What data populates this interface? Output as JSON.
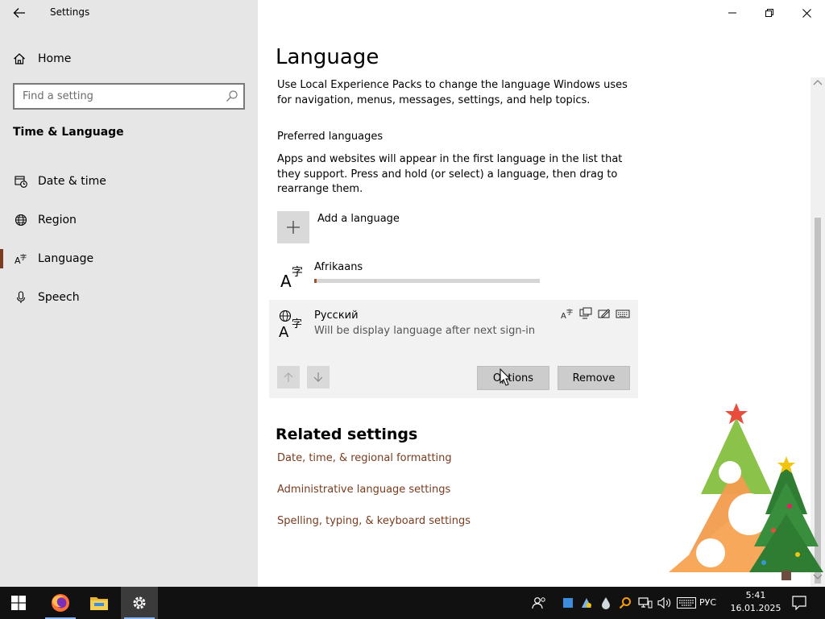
{
  "app": {
    "title": "Settings"
  },
  "sidebar": {
    "home_label": "Home",
    "search_placeholder": "Find a setting",
    "section_title": "Time & Language",
    "items": [
      {
        "label": "Date & time",
        "icon": "calendar-clock-icon"
      },
      {
        "label": "Region",
        "icon": "globe-icon"
      },
      {
        "label": "Language",
        "icon": "language-icon",
        "active": true
      },
      {
        "label": "Speech",
        "icon": "microphone-icon"
      }
    ]
  },
  "main": {
    "title": "Language",
    "intro": "Use Local Experience Packs to change the language Windows uses for navigation, menus, messages, settings, and help topics.",
    "preferred_title": "Preferred languages",
    "preferred_desc": "Apps and websites will appear in the first language in the list that they support. Press and hold (or select) a language, then drag to rearrange them.",
    "add_language_label": "Add a language",
    "languages": [
      {
        "name": "Afrikaans",
        "download_progress": 0.01
      },
      {
        "name": "Русский",
        "status": "Will be display language after next sign-in",
        "selected": true
      }
    ],
    "options_label": "Options",
    "remove_label": "Remove",
    "related_title": "Related settings",
    "related_links": [
      "Date, time, & regional formatting",
      "Administrative language settings",
      "Spelling, typing, & keyboard settings"
    ]
  },
  "taskbar": {
    "apps": [
      "start-icon",
      "firefox-icon",
      "file-explorer-icon",
      "settings-icon"
    ],
    "input_language": "РУС",
    "time": "5:41",
    "date": "16.01.2025"
  },
  "colors": {
    "accent": "#7a3b1e",
    "sidebar_bg": "#e6e6e6",
    "taskbar_bg": "#111111",
    "selected_row_bg": "#f2f2f2"
  }
}
